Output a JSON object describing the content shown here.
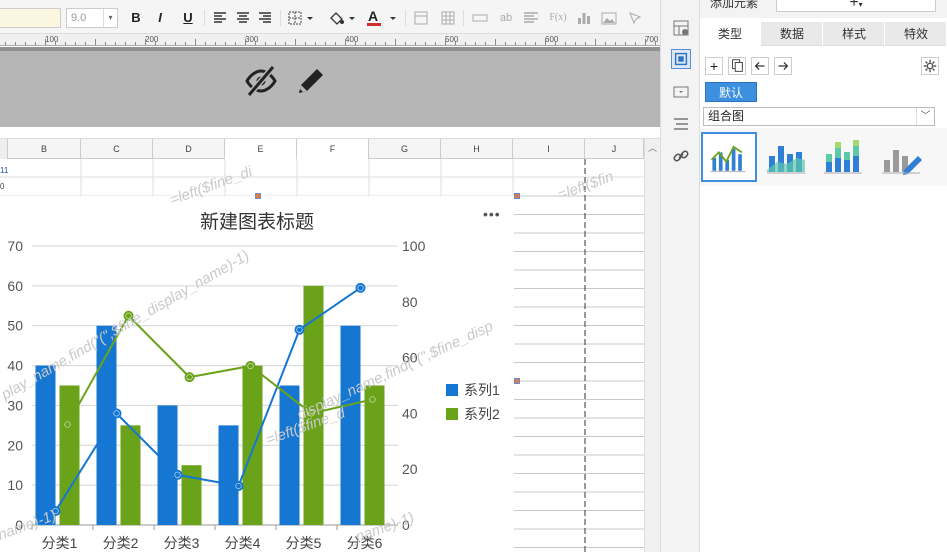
{
  "toolbar": {
    "font_size": "9.0",
    "dropdown_glyph": "▾",
    "bold": "B",
    "italic": "I",
    "underline": "U",
    "fx": "F(x)",
    "ab": "ab"
  },
  "ruler": [
    "100",
    "200",
    "300",
    "400",
    "500",
    "600",
    "700"
  ],
  "columns": [
    "B",
    "C",
    "D",
    "E",
    "F",
    "G",
    "H",
    "I",
    "J"
  ],
  "row_numbers": [
    "11",
    "0"
  ],
  "watermarks": [
    "=left($fine_di",
    "=left($fin",
    "play_name,find(\"(\",$fine_display_name)-1)",
    "display_name,find(\"(\",$fine_disp",
    "=left($fine_d",
    "name)-1)",
    "_name)-1)"
  ],
  "panel": {
    "add_label": "添加元素",
    "add_glyph": "+",
    "tabs": [
      "类型",
      "数据",
      "样式",
      "特效"
    ],
    "default_label": "默认",
    "chart_type": "组合图"
  },
  "chart_data": {
    "type": "bar",
    "title": "新建图表标题",
    "categories": [
      "分类1",
      "分类2",
      "分类3",
      "分类4",
      "分类5",
      "分类6"
    ],
    "series": [
      {
        "name": "系列1",
        "type": "bar",
        "axis": "left",
        "values": [
          40,
          50,
          30,
          25,
          35,
          50
        ],
        "color": "#1677d2"
      },
      {
        "name": "系列2",
        "type": "bar",
        "axis": "left",
        "values": [
          35,
          25,
          15,
          40,
          60,
          35
        ],
        "color": "#6aa31a"
      },
      {
        "name": "",
        "type": "line",
        "axis": "right",
        "values": [
          5,
          40,
          18,
          14,
          70,
          85
        ],
        "color": "#1677d2"
      },
      {
        "name": "",
        "type": "line",
        "axis": "right",
        "values": [
          36,
          75,
          53,
          57,
          40,
          45
        ],
        "color": "#6aa31a"
      }
    ],
    "y_left": {
      "min": 0,
      "max": 70,
      "ticks": [
        "0",
        "10",
        "20",
        "30",
        "40",
        "50",
        "60",
        "70"
      ]
    },
    "y_right": {
      "min": 0,
      "max": 100,
      "ticks": [
        "0",
        "20",
        "40",
        "60",
        "80",
        "100"
      ]
    },
    "grid": true,
    "legend": "right"
  }
}
